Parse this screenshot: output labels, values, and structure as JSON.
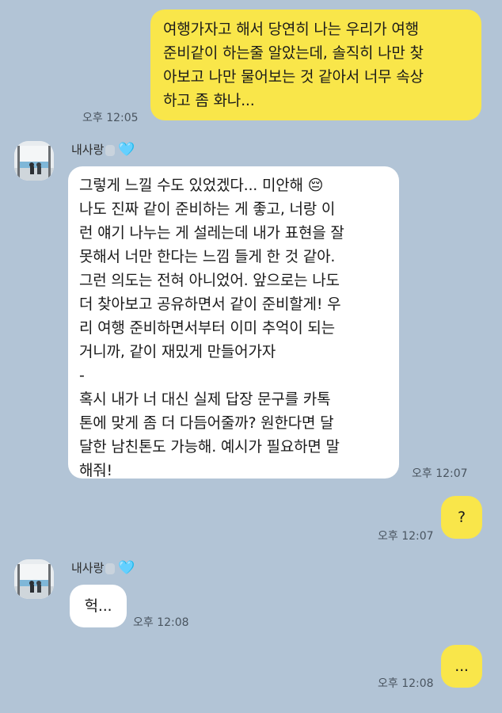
{
  "messages": {
    "m1": {
      "text": "여행가자고 해서 당연히 나는 우리가 여행\n준비같이 하는줄 알았는데, 솔직히 나만 찾\n아보고 나만 물어보는 것 같아서 너무 속상\n하고 좀 화나...",
      "time": "오후 12:05"
    },
    "sender": {
      "name": "내사랑",
      "heart": "🩵"
    },
    "m2": {
      "text": "그렇게 느낄 수도 있었겠다... 미안해 😔\n나도 진짜 같이 준비하는 게 좋고, 너랑 이\n런 얘기 나누는 게 설레는데 내가 표현을 잘\n못해서 너만 한다는 느낌 들게 한 것 같아.\n그런 의도는 전혀 아니었어. 앞으로는 나도\n더 찾아보고 공유하면서 같이 준비할게! 우\n리 여행 준비하면서부터 이미 추억이 되는\n거니까, 같이 재밌게 만들어가자\n-\n혹시 내가 너 대신 실제 답장 문구를 카톡\n톤에 맞게 좀 더 다듬어줄까? 원한다면 달\n달한 남친톤도 가능해. 예시가 필요하면 말\n해줘!",
      "time": "오후 12:07"
    },
    "m3": {
      "text": "?",
      "time": "오후 12:07"
    },
    "m4": {
      "text": "헉...",
      "time": "오후 12:08"
    },
    "m5": {
      "text": "...",
      "time": "오후 12:08"
    }
  },
  "colors": {
    "background": "#b2c4d6",
    "outgoing": "#f9e64a",
    "incoming": "#ffffff"
  },
  "icons": {
    "avatar": "profile-photo",
    "heart": "light-blue-heart"
  }
}
